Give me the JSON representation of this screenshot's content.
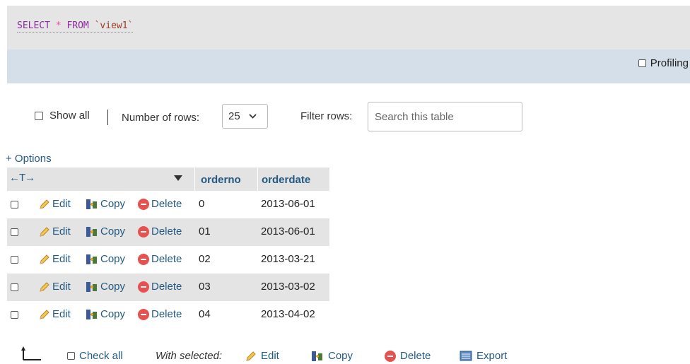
{
  "sql": {
    "select": "SELECT",
    "star": "*",
    "from": "FROM",
    "table": "`view1`"
  },
  "profiling": {
    "label": "Profiling",
    "checked": false
  },
  "nav": {
    "show_all_label": "Show all",
    "number_of_rows_label": "Number of rows:",
    "rows_value": "25",
    "filter_label": "Filter rows:",
    "search_placeholder": "Search this table"
  },
  "options_label": "+ Options",
  "table": {
    "columns": [
      "orderno",
      "orderdate"
    ],
    "action_labels": {
      "edit": "Edit",
      "copy": "Copy",
      "delete": "Delete"
    },
    "rows": [
      {
        "orderno": "0",
        "orderdate": "2013-06-01"
      },
      {
        "orderno": "01",
        "orderdate": "2013-06-01"
      },
      {
        "orderno": "02",
        "orderdate": "2013-03-21"
      },
      {
        "orderno": "03",
        "orderdate": "2013-03-02"
      },
      {
        "orderno": "04",
        "orderdate": "2013-04-02"
      }
    ]
  },
  "footer": {
    "check_all": "Check all",
    "with_selected": "With selected:",
    "edit": "Edit",
    "copy": "Copy",
    "delete": "Delete",
    "export": "Export"
  },
  "colors": {
    "link": "#235a81",
    "keyword": "#8b2a9f",
    "delete": "#e85050"
  }
}
